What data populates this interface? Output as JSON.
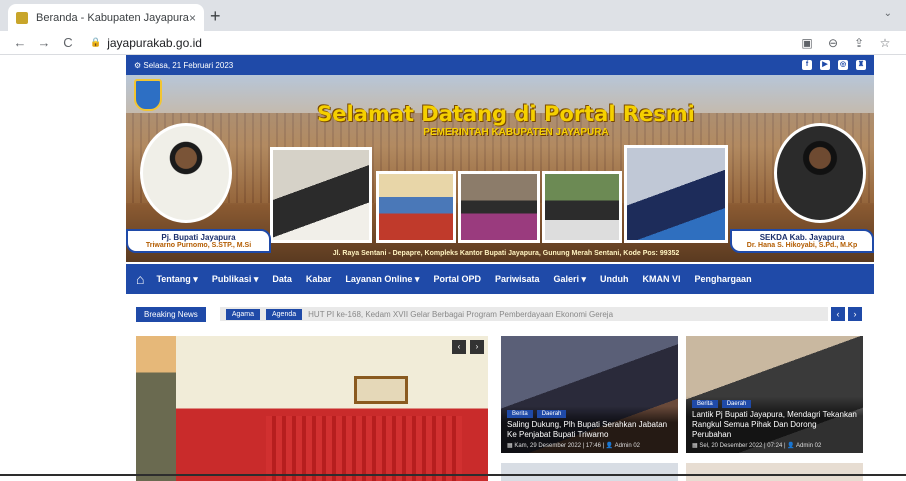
{
  "browser": {
    "tab_title": "Beranda - Kabupaten Jayapura",
    "tab_close": "×",
    "new_tab": "+",
    "tab_menu": "⌄",
    "url": "jayapurakab.go.id",
    "back": "←",
    "forward": "→",
    "reload": "C",
    "lock": "🔒",
    "right_icons": [
      "▣",
      "⊖",
      "⇪",
      "☆"
    ]
  },
  "topbar": {
    "date": "⚙ Selasa, 21 Februari 2023",
    "social": [
      "f",
      "▶",
      "◎",
      "♜"
    ]
  },
  "banner": {
    "headline": "Selamat Datang di Portal Resmi",
    "subheadline": "PEMERINTAH KABUPATEN JAYAPURA",
    "left_name": "Pj. Bupati Jayapura",
    "left_person": "Triwarno Purnomo, S.STP., M.Si",
    "right_name": "SEKDA Kab. Jayapura",
    "right_person": "Dr. Hana S. Hikoyabi, S.Pd., M.Kp",
    "address": "Jl. Raya Sentani - Depapre, Kompleks Kantor Bupati Jayapura, Gunung Merah Sentani, Kode Pos: 99352"
  },
  "menu": {
    "home_icon": "⌂",
    "items": [
      "Tentang ▾",
      "Publikasi ▾",
      "Data",
      "Kabar",
      "Layanan Online ▾",
      "Portal OPD",
      "Pariwisata",
      "Galeri ▾",
      "Unduh",
      "KMAN VI",
      "Penghargaan"
    ]
  },
  "breaking": {
    "label": "Breaking News",
    "tag1": "Agama",
    "tag2": "Agenda",
    "text": "HUT PI ke-168, Kedam XVII Gelar Berbagai Program Pemberdayaan Ekonomi Gereja",
    "prev": "‹",
    "next": "›"
  },
  "feature": {
    "prev": "‹",
    "next": "›"
  },
  "cards": [
    {
      "tags": [
        "Berita",
        "Daerah"
      ],
      "title": "Saling Dukung, Plh Bupati Serahkan Jabatan Ke Penjabat Bupati Triwarno",
      "meta": "▦ Kam, 29 Desember 2022 | 17:46 | 👤 Admin 02"
    },
    {
      "tags": [
        "Berita",
        "Daerah"
      ],
      "title": "Lantik Pj Bupati Jayapura, Mendagri Tekankan Rangkul Semua Pihak Dan Dorong Perubahan",
      "meta": "▦ Sel, 20 Desember 2022 | 07:24 | 👤 Admin 02"
    }
  ]
}
